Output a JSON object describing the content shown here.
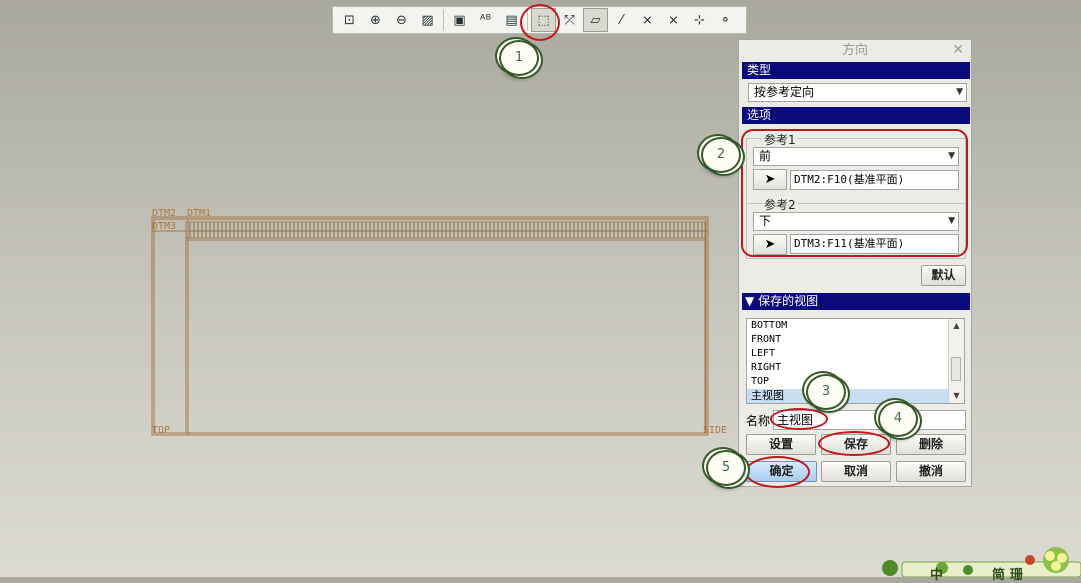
{
  "toolbar": {
    "buttons": [
      {
        "icon": "refit-icon",
        "glyph": "⊡"
      },
      {
        "icon": "zoom-in-icon",
        "glyph": "⊕"
      },
      {
        "icon": "zoom-out-icon",
        "glyph": "⊖"
      },
      {
        "icon": "repaint-icon",
        "glyph": "▨"
      },
      {
        "icon": "shaded-view-icon",
        "glyph": "▣"
      },
      {
        "icon": "annotation-icon",
        "glyph": "ᴬᴮ"
      },
      {
        "icon": "saved-views-icon",
        "glyph": "▤"
      },
      {
        "icon": "reorient-icon",
        "glyph": "⬚"
      },
      {
        "icon": "datum-display-icon",
        "glyph": "⤱"
      },
      {
        "icon": "datum-plane-icon",
        "glyph": "▱"
      },
      {
        "icon": "datum-axis-icon",
        "glyph": "⁄"
      },
      {
        "icon": "point-display-icon",
        "glyph": "⨯"
      },
      {
        "icon": "csys-display-icon",
        "glyph": "⨯"
      },
      {
        "icon": "spin-center-icon",
        "glyph": "⊹"
      },
      {
        "icon": "sketch-node-icon",
        "glyph": "⚬"
      }
    ]
  },
  "model": {
    "labels": {
      "dtm2": "DTM2",
      "dtm1": "DTM1",
      "dtm3": "DTM3",
      "top": "TOP",
      "side": "SIDE"
    }
  },
  "dialog": {
    "title": "方向",
    "type_section": "类型",
    "type_value": "按参考定向",
    "options_section": "选项",
    "ref1_label": "参考1",
    "ref1_value": "前",
    "ref1_field": "DTM2:F10(基准平面)",
    "ref2_label": "参考2",
    "ref2_value": "下",
    "ref2_field": "DTM3:F11(基准平面)",
    "default_button": "默认",
    "saved_views_section": "保存的视图",
    "saved_views": [
      "BOTTOM",
      "FRONT",
      "LEFT",
      "RIGHT",
      "TOP",
      "主视图"
    ],
    "name_label": "名称",
    "name_value": "主视图",
    "set_button": "设置",
    "save_button": "保存",
    "delete_button": "删除",
    "ok_button": "确定",
    "cancel_button": "取消",
    "undo_button": "撤消"
  },
  "callouts": [
    "1",
    "2",
    "3",
    "4",
    "5"
  ],
  "corner": {
    "text1": "中",
    "text2": "简",
    "text3": "珊"
  },
  "colors": {
    "section_bar": "#0a0a7a",
    "callout_red": "#c2171c",
    "callout_green": "#35582b",
    "model_line": "#b0783a"
  }
}
